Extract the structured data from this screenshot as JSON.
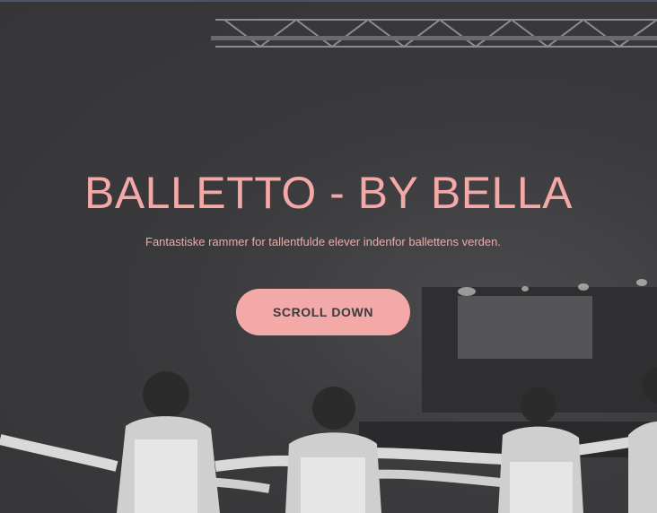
{
  "hero": {
    "title": "BALLETTO - BY BELLA",
    "subtitle": "Fantastiske rammer for tallentfulde elever indenfor ballettens verden.",
    "cta_label": "SCROLL DOWN",
    "background_image": "black-and-white photo of ballet dancers on stage",
    "accent_color": "#f2a9a8",
    "background_color": "#3a3a3c"
  }
}
